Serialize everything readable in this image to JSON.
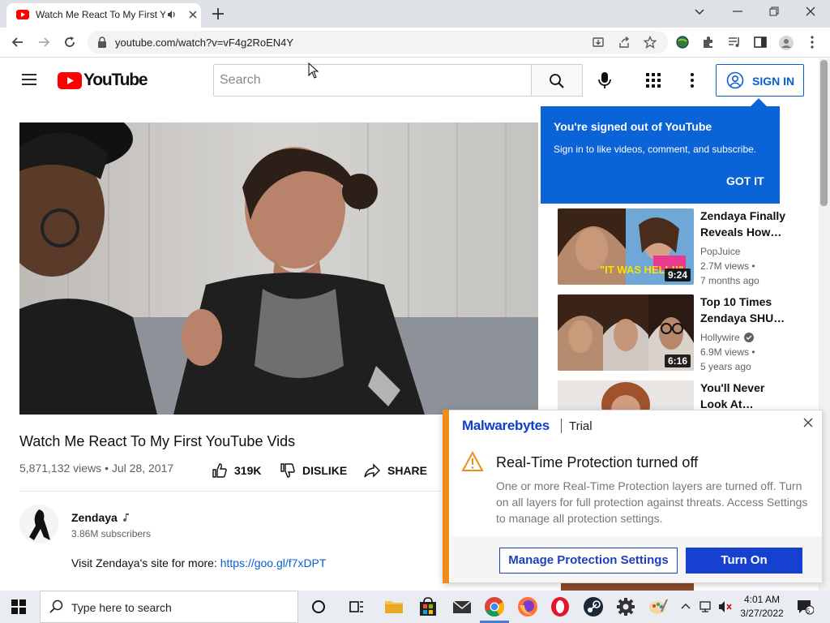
{
  "browser": {
    "tab_title": "Watch Me React To My First YouTube Vids",
    "url": "youtube.com/watch?v=vF4g2RoEN4Y"
  },
  "youtube": {
    "logo_text": "YouTube",
    "search_placeholder": "Search",
    "sign_in_label": "SIGN IN",
    "video": {
      "title": "Watch Me React To My First YouTube Vids",
      "meta": "5,871,132 views • Jul 28, 2017",
      "like_count": "319K",
      "dislike_label": "DISLIKE",
      "share_label": "SHARE"
    },
    "channel": {
      "name": "Zendaya",
      "subscribers": "3.86M subscribers"
    },
    "description": {
      "text": "Visit Zendaya's site for more: ",
      "link": "https://goo.gl/f7xDPT"
    },
    "popup": {
      "title": "You're signed out of YouTube",
      "body": "Sign in to like videos, comment, and subscribe.",
      "button": "GOT IT"
    },
    "recommendations": [
      {
        "title_line1": "Zendaya Finally",
        "title_line2": "Reveals How…",
        "channel": "PopJuice",
        "views": "2.7M views •",
        "age": "7 months ago",
        "duration": "9:24",
        "overlay_text": "\"IT WAS HELL!!\""
      },
      {
        "title_line1": "Top 10 Times",
        "title_line2": "Zendaya SHU…",
        "channel": "Hollywire",
        "views": "6.9M views •",
        "age": "5 years ago",
        "duration": "6:16"
      },
      {
        "title_line1": "You'll Never",
        "title_line2": "Look At…"
      }
    ]
  },
  "malwarebytes": {
    "brand": "Malwarebytes",
    "edition": "Trial",
    "title": "Real-Time Protection turned off",
    "body": "One or more Real-Time Protection layers are turned off. Turn on all layers for full protection against threats. Access Settings to manage all protection settings.",
    "manage_label": "Manage Protection Settings",
    "turn_on_label": "Turn On",
    "accent_color": "#ef8c1c"
  },
  "taskbar": {
    "search_placeholder": "Type here to search",
    "time": "4:01 AM",
    "date": "3/27/2022",
    "notification_count": "5"
  }
}
